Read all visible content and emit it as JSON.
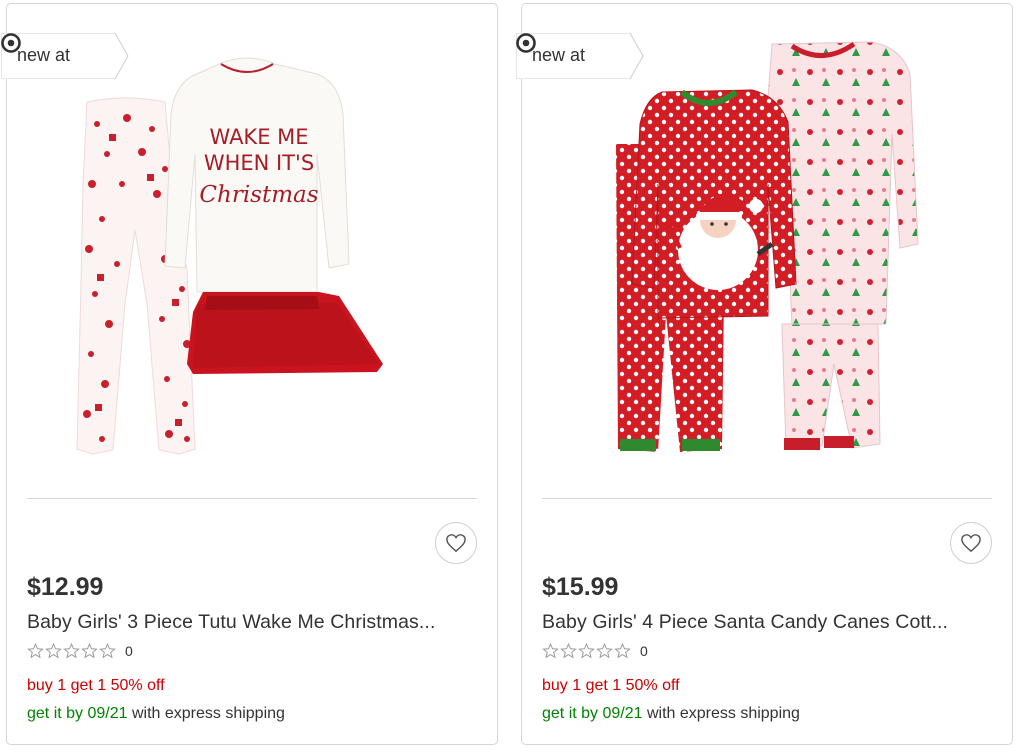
{
  "products": [
    {
      "badge": "new at",
      "price": "$12.99",
      "title": "Baby Girls' 3 Piece Tutu Wake Me Christmas...",
      "rating_count": "0",
      "promo": "buy 1 get 1 50% off",
      "delivery_date": "get it by 09/21",
      "delivery_suffix": " with express shipping",
      "image_text": [
        "WAKE ME",
        "WHEN IT'S",
        "Christmas"
      ]
    },
    {
      "badge": "new at",
      "price": "$15.99",
      "title": "Baby Girls' 4 Piece Santa Candy Canes Cott...",
      "rating_count": "0",
      "promo": "buy 1 get 1 50% off",
      "delivery_date": "get it by 09/21",
      "delivery_suffix": " with express shipping"
    }
  ],
  "colors": {
    "brand_red": "#cc0000",
    "ship_green": "#008300",
    "border": "#d6d6d6"
  },
  "icons": [
    "target-bullseye-icon",
    "heart-icon",
    "star-outline-icon"
  ]
}
